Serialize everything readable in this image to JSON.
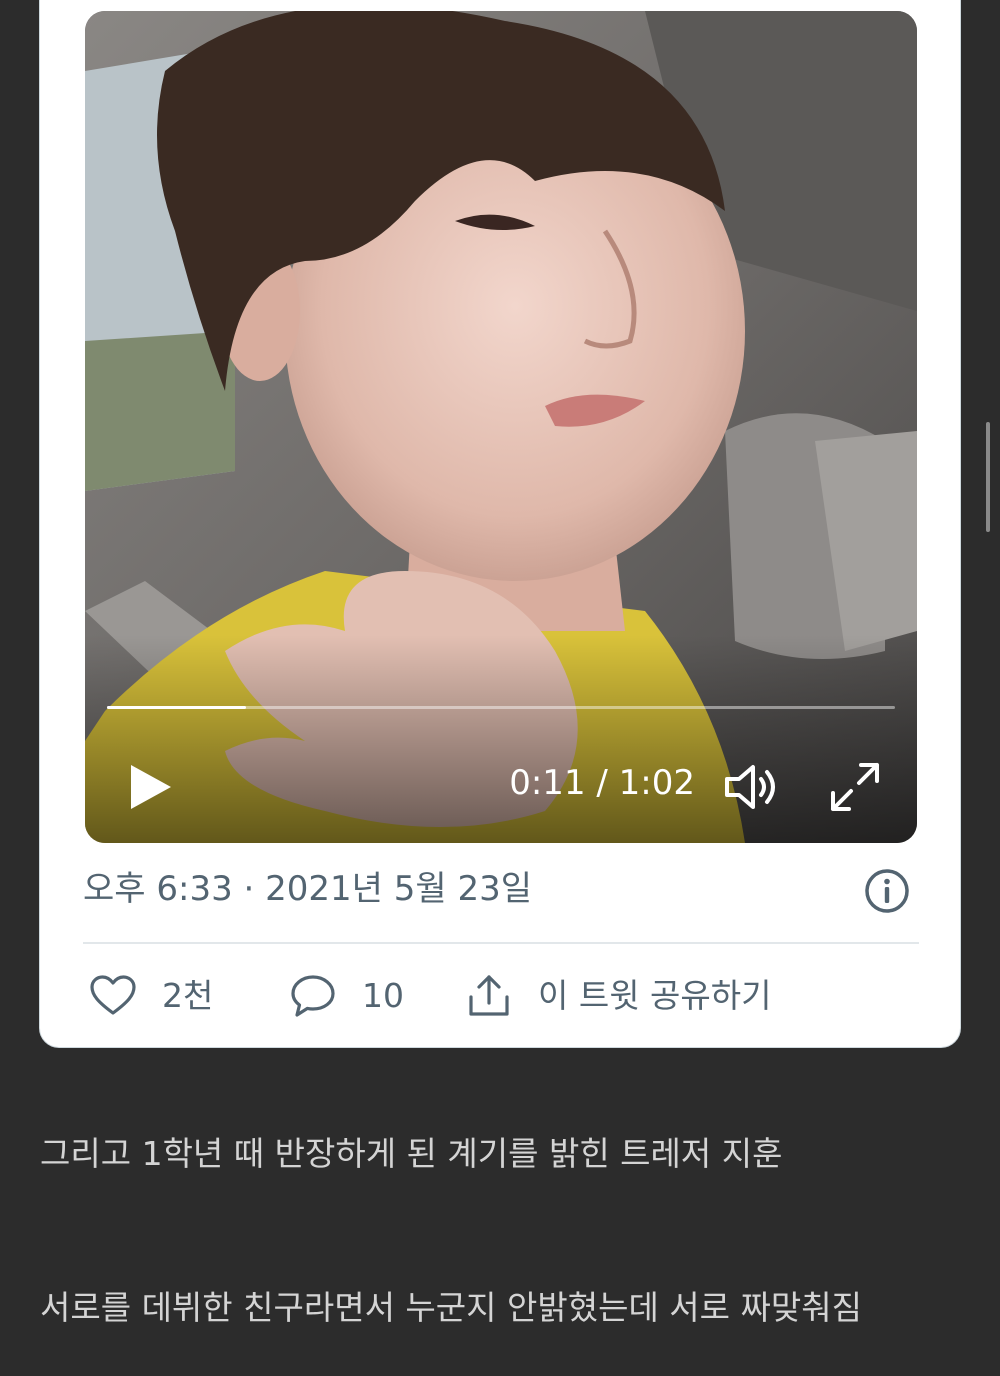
{
  "tweet": {
    "video": {
      "current_time": "0:11",
      "duration": "1:02",
      "time_display": "0:11 / 1:02",
      "progress_fraction": 0.177
    },
    "timestamp": "오후 6:33 · 2021년 5월 23일",
    "actions": {
      "like_count": "2천",
      "reply_count": "10",
      "share_label": "이 트윗 공유하기"
    }
  },
  "article": {
    "paragraphs": [
      "그리고 1학년 때 반장하게 된 계기를 밝힌 트레저 지훈",
      "서로를 데뷔한 친구라면서 누군지 안밝혔는데 서로 짜맞춰짐"
    ]
  },
  "icons": {
    "play": "play-icon",
    "volume": "volume-icon",
    "fullscreen": "fullscreen-icon",
    "info": "info-icon",
    "like": "heart-icon",
    "reply": "reply-icon",
    "share": "share-icon"
  },
  "colors": {
    "page_background": "#2c2c2c",
    "card_background": "#ffffff",
    "secondary_text": "#536471",
    "body_text": "#d4d4d4"
  }
}
